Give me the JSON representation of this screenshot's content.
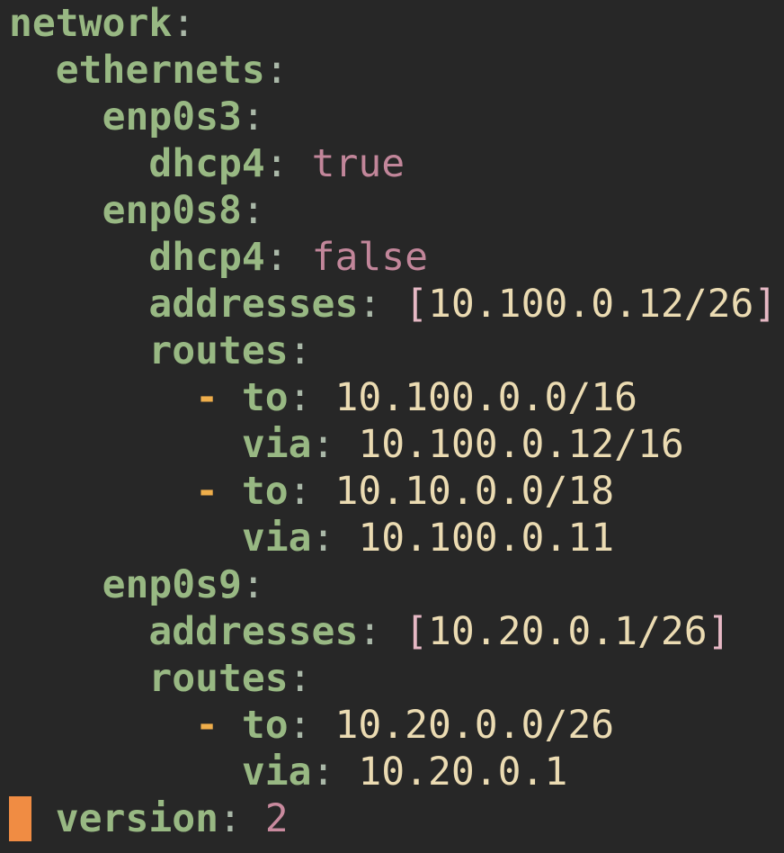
{
  "editor": {
    "lines": [
      {
        "indent": "",
        "key": "network",
        "sep": ":"
      },
      {
        "indent": "  ",
        "key": "ethernets",
        "sep": ":"
      },
      {
        "indent": "    ",
        "key": "enp0s3",
        "sep": ":"
      },
      {
        "indent": "      ",
        "key": "dhcp4",
        "sep": ": ",
        "value": "true"
      },
      {
        "indent": "    ",
        "key": "enp0s8",
        "sep": ":"
      },
      {
        "indent": "      ",
        "key": "dhcp4",
        "sep": ": ",
        "value": "false"
      },
      {
        "indent": "      ",
        "key": "addresses",
        "sep": ": ",
        "open": "[",
        "value": "10.100.0.12/26",
        "close": "]"
      },
      {
        "indent": "      ",
        "key": "routes",
        "sep": ":"
      },
      {
        "indent": "        ",
        "dash": "- ",
        "key": "to",
        "sep": ": ",
        "value": "10.100.0.0/16"
      },
      {
        "indent": "          ",
        "key": "via",
        "sep": ": ",
        "value": "10.100.0.12/16"
      },
      {
        "indent": "        ",
        "dash": "- ",
        "key": "to",
        "sep": ": ",
        "value": "10.10.0.0/18"
      },
      {
        "indent": "          ",
        "key": "via",
        "sep": ": ",
        "value": "10.100.0.11"
      },
      {
        "indent": "    ",
        "key": "enp0s9",
        "sep": ":"
      },
      {
        "indent": "      ",
        "key": "addresses",
        "sep": ": ",
        "open": "[",
        "value": "10.20.0.1/26",
        "close": "]"
      },
      {
        "indent": "      ",
        "key": "routes",
        "sep": ":"
      },
      {
        "indent": "        ",
        "dash": "- ",
        "key": "to",
        "sep": ": ",
        "value": "10.20.0.0/26"
      },
      {
        "indent": "          ",
        "key": "via",
        "sep": ": ",
        "value": "10.20.0.1"
      },
      {
        "indent": "  ",
        "key": "version",
        "sep": ": ",
        "value": "2"
      }
    ],
    "colors": {
      "background": "#272727",
      "key": "#98b883",
      "boolean": "#c2869a",
      "number": "#c98a9e",
      "string": "#ebdbb2",
      "dash": "#efae4b",
      "cursor": "#f08c43"
    }
  }
}
